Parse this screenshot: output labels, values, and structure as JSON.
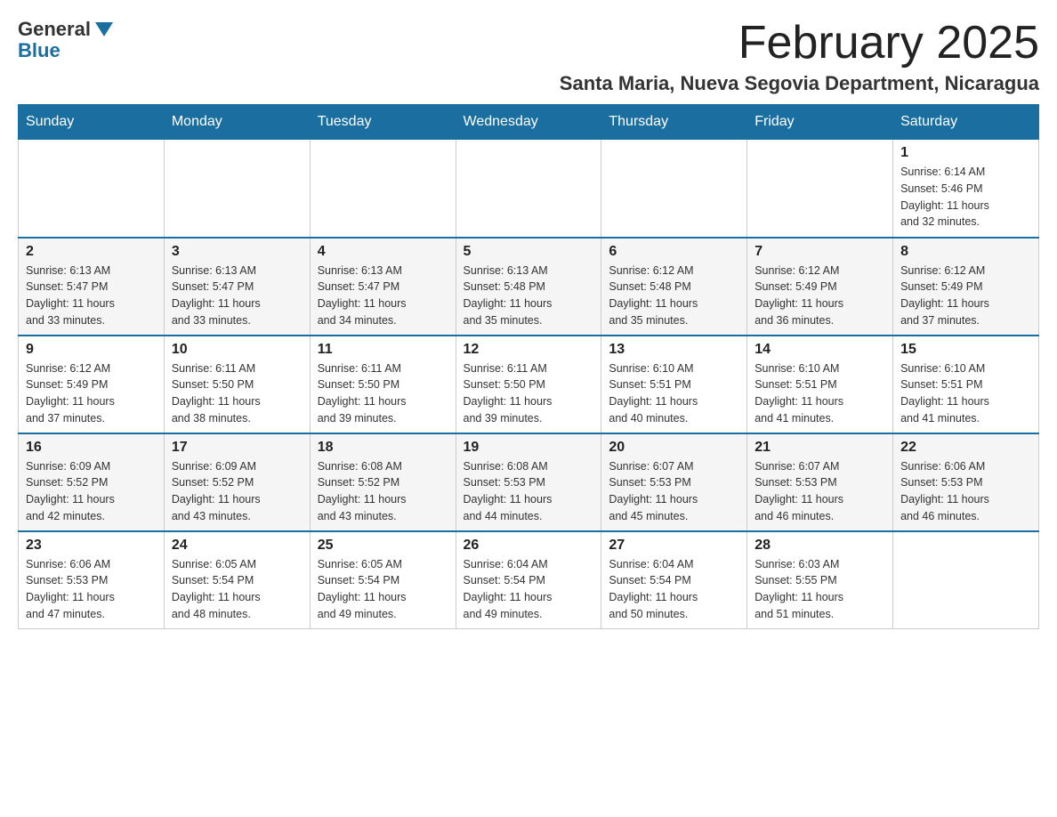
{
  "header": {
    "logo_general": "General",
    "logo_blue": "Blue",
    "month_title": "February 2025",
    "location": "Santa Maria, Nueva Segovia Department, Nicaragua"
  },
  "weekdays": [
    "Sunday",
    "Monday",
    "Tuesday",
    "Wednesday",
    "Thursday",
    "Friday",
    "Saturday"
  ],
  "weeks": [
    {
      "days": [
        {
          "number": "",
          "info": ""
        },
        {
          "number": "",
          "info": ""
        },
        {
          "number": "",
          "info": ""
        },
        {
          "number": "",
          "info": ""
        },
        {
          "number": "",
          "info": ""
        },
        {
          "number": "",
          "info": ""
        },
        {
          "number": "1",
          "info": "Sunrise: 6:14 AM\nSunset: 5:46 PM\nDaylight: 11 hours\nand 32 minutes."
        }
      ]
    },
    {
      "days": [
        {
          "number": "2",
          "info": "Sunrise: 6:13 AM\nSunset: 5:47 PM\nDaylight: 11 hours\nand 33 minutes."
        },
        {
          "number": "3",
          "info": "Sunrise: 6:13 AM\nSunset: 5:47 PM\nDaylight: 11 hours\nand 33 minutes."
        },
        {
          "number": "4",
          "info": "Sunrise: 6:13 AM\nSunset: 5:47 PM\nDaylight: 11 hours\nand 34 minutes."
        },
        {
          "number": "5",
          "info": "Sunrise: 6:13 AM\nSunset: 5:48 PM\nDaylight: 11 hours\nand 35 minutes."
        },
        {
          "number": "6",
          "info": "Sunrise: 6:12 AM\nSunset: 5:48 PM\nDaylight: 11 hours\nand 35 minutes."
        },
        {
          "number": "7",
          "info": "Sunrise: 6:12 AM\nSunset: 5:49 PM\nDaylight: 11 hours\nand 36 minutes."
        },
        {
          "number": "8",
          "info": "Sunrise: 6:12 AM\nSunset: 5:49 PM\nDaylight: 11 hours\nand 37 minutes."
        }
      ]
    },
    {
      "days": [
        {
          "number": "9",
          "info": "Sunrise: 6:12 AM\nSunset: 5:49 PM\nDaylight: 11 hours\nand 37 minutes."
        },
        {
          "number": "10",
          "info": "Sunrise: 6:11 AM\nSunset: 5:50 PM\nDaylight: 11 hours\nand 38 minutes."
        },
        {
          "number": "11",
          "info": "Sunrise: 6:11 AM\nSunset: 5:50 PM\nDaylight: 11 hours\nand 39 minutes."
        },
        {
          "number": "12",
          "info": "Sunrise: 6:11 AM\nSunset: 5:50 PM\nDaylight: 11 hours\nand 39 minutes."
        },
        {
          "number": "13",
          "info": "Sunrise: 6:10 AM\nSunset: 5:51 PM\nDaylight: 11 hours\nand 40 minutes."
        },
        {
          "number": "14",
          "info": "Sunrise: 6:10 AM\nSunset: 5:51 PM\nDaylight: 11 hours\nand 41 minutes."
        },
        {
          "number": "15",
          "info": "Sunrise: 6:10 AM\nSunset: 5:51 PM\nDaylight: 11 hours\nand 41 minutes."
        }
      ]
    },
    {
      "days": [
        {
          "number": "16",
          "info": "Sunrise: 6:09 AM\nSunset: 5:52 PM\nDaylight: 11 hours\nand 42 minutes."
        },
        {
          "number": "17",
          "info": "Sunrise: 6:09 AM\nSunset: 5:52 PM\nDaylight: 11 hours\nand 43 minutes."
        },
        {
          "number": "18",
          "info": "Sunrise: 6:08 AM\nSunset: 5:52 PM\nDaylight: 11 hours\nand 43 minutes."
        },
        {
          "number": "19",
          "info": "Sunrise: 6:08 AM\nSunset: 5:53 PM\nDaylight: 11 hours\nand 44 minutes."
        },
        {
          "number": "20",
          "info": "Sunrise: 6:07 AM\nSunset: 5:53 PM\nDaylight: 11 hours\nand 45 minutes."
        },
        {
          "number": "21",
          "info": "Sunrise: 6:07 AM\nSunset: 5:53 PM\nDaylight: 11 hours\nand 46 minutes."
        },
        {
          "number": "22",
          "info": "Sunrise: 6:06 AM\nSunset: 5:53 PM\nDaylight: 11 hours\nand 46 minutes."
        }
      ]
    },
    {
      "days": [
        {
          "number": "23",
          "info": "Sunrise: 6:06 AM\nSunset: 5:53 PM\nDaylight: 11 hours\nand 47 minutes."
        },
        {
          "number": "24",
          "info": "Sunrise: 6:05 AM\nSunset: 5:54 PM\nDaylight: 11 hours\nand 48 minutes."
        },
        {
          "number": "25",
          "info": "Sunrise: 6:05 AM\nSunset: 5:54 PM\nDaylight: 11 hours\nand 49 minutes."
        },
        {
          "number": "26",
          "info": "Sunrise: 6:04 AM\nSunset: 5:54 PM\nDaylight: 11 hours\nand 49 minutes."
        },
        {
          "number": "27",
          "info": "Sunrise: 6:04 AM\nSunset: 5:54 PM\nDaylight: 11 hours\nand 50 minutes."
        },
        {
          "number": "28",
          "info": "Sunrise: 6:03 AM\nSunset: 5:55 PM\nDaylight: 11 hours\nand 51 minutes."
        },
        {
          "number": "",
          "info": ""
        }
      ]
    }
  ]
}
